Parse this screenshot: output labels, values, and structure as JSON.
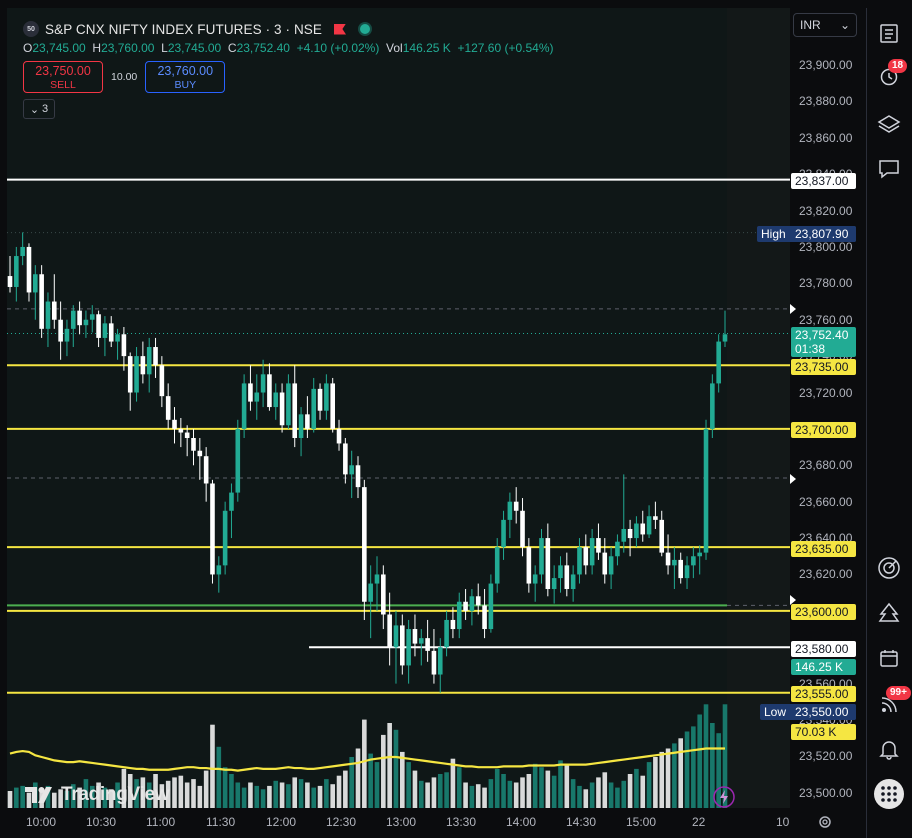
{
  "header": {
    "symbol_badge": "50",
    "title": "S&P CNX NIFTY INDEX FUTURES · 3 · NSE",
    "ohlc": {
      "o_label": "O",
      "o": "23,745.00",
      "h_label": "H",
      "h": "23,760.00",
      "l_label": "L",
      "l": "23,745.00",
      "c_label": "C",
      "c": "23,752.40",
      "change": "+4.10 (+0.02%)",
      "vol_label": "Vol",
      "vol": "146.25 K",
      "vol_change": "+127.60 (+0.54%)"
    }
  },
  "trade": {
    "sell_price": "23,750.00",
    "sell_label": "SELL",
    "spread": "10.00",
    "buy_price": "23,760.00",
    "buy_label": "BUY"
  },
  "layers": {
    "count": "3"
  },
  "currency": {
    "value": "INR"
  },
  "price_axis": {
    "ticks": [
      "23,900.00",
      "23,880.00",
      "23,860.00",
      "23,840.00",
      "23,820.00",
      "23,800.00",
      "23,780.00",
      "23,760.00",
      "23,740.00",
      "23,720.00",
      "23,700.00",
      "23,680.00",
      "23,660.00",
      "23,640.00",
      "23,620.00",
      "23,600.00",
      "23,580.00",
      "23,560.00",
      "23,540.00",
      "23,520.00",
      "23,500.00"
    ],
    "tick_values": [
      23900,
      23880,
      23860,
      23840,
      23820,
      23800,
      23780,
      23760,
      23740,
      23720,
      23700,
      23680,
      23660,
      23640,
      23620,
      23600,
      23580,
      23560,
      23540,
      23520,
      23500
    ]
  },
  "time_axis": [
    "10:00",
    "10:30",
    "11:00",
    "11:30",
    "12:00",
    "12:30",
    "13:00",
    "13:30",
    "14:00",
    "14:30",
    "15:00",
    "22",
    "10"
  ],
  "labels": {
    "line_837": "23,837.00",
    "high_tag": "High",
    "high": "23,807.90",
    "last_price": "23,752.40",
    "countdown": "01:38",
    "line_735": "23,735.00",
    "line_700": "23,700.00",
    "line_635": "23,635.00",
    "line_600": "23,600.00",
    "line_580": "23,580.00",
    "volume": "146.25 K",
    "line_555": "23,555.00",
    "low_tag": "Low",
    "low": "23,550.00",
    "vol_ma": "70.03 K"
  },
  "sidebar": {
    "alerts_badge": "18",
    "notifications_badge": "99+"
  },
  "branding": {
    "logo_text": "TradingView"
  },
  "colors": {
    "up": "#22ab94",
    "down": "#ffffff",
    "hline": "#f5e642",
    "white_line": "#ffffff",
    "last": "#22ab94",
    "high_low": "#1e3a6e",
    "ma": "#f5e642"
  },
  "chart_data": {
    "type": "candlestick",
    "price_range": [
      23492,
      23912
    ],
    "horizontal_lines": [
      23837,
      23735,
      23700,
      23635,
      23600,
      23555
    ],
    "white_segment": 23580,
    "green_dotted": 23603,
    "candles": [
      [
        23784,
        23795,
        23775,
        23778
      ],
      [
        23778,
        23800,
        23770,
        23795
      ],
      [
        23795,
        23808,
        23790,
        23800
      ],
      [
        23800,
        23802,
        23770,
        23775
      ],
      [
        23775,
        23790,
        23760,
        23785
      ],
      [
        23785,
        23790,
        23750,
        23755
      ],
      [
        23755,
        23775,
        23745,
        23770
      ],
      [
        23770,
        23785,
        23755,
        23760
      ],
      [
        23760,
        23770,
        23738,
        23748
      ],
      [
        23748,
        23760,
        23740,
        23755
      ],
      [
        23755,
        23768,
        23745,
        23765
      ],
      [
        23765,
        23770,
        23752,
        23757
      ],
      [
        23757,
        23765,
        23750,
        23760
      ],
      [
        23760,
        23768,
        23753,
        23763
      ],
      [
        23763,
        23765,
        23745,
        23750
      ],
      [
        23750,
        23762,
        23740,
        23758
      ],
      [
        23758,
        23762,
        23745,
        23748
      ],
      [
        23748,
        23755,
        23738,
        23752
      ],
      [
        23752,
        23756,
        23732,
        23740
      ],
      [
        23740,
        23742,
        23710,
        23720
      ],
      [
        23720,
        23745,
        23715,
        23740
      ],
      [
        23740,
        23748,
        23725,
        23730
      ],
      [
        23730,
        23750,
        23720,
        23745
      ],
      [
        23745,
        23750,
        23728,
        23735
      ],
      [
        23735,
        23740,
        23712,
        23718
      ],
      [
        23718,
        23725,
        23700,
        23705
      ],
      [
        23705,
        23712,
        23692,
        23700
      ],
      [
        23700,
        23706,
        23690,
        23698
      ],
      [
        23698,
        23702,
        23685,
        23695
      ],
      [
        23695,
        23700,
        23680,
        23688
      ],
      [
        23688,
        23695,
        23672,
        23685
      ],
      [
        23685,
        23690,
        23660,
        23670
      ],
      [
        23670,
        23672,
        23615,
        23620
      ],
      [
        23620,
        23630,
        23610,
        23625
      ],
      [
        23625,
        23660,
        23620,
        23655
      ],
      [
        23655,
        23670,
        23640,
        23665
      ],
      [
        23665,
        23705,
        23660,
        23700
      ],
      [
        23700,
        23730,
        23695,
        23725
      ],
      [
        23725,
        23735,
        23710,
        23715
      ],
      [
        23715,
        23730,
        23705,
        23720
      ],
      [
        23720,
        23738,
        23712,
        23730
      ],
      [
        23730,
        23736,
        23710,
        23712
      ],
      [
        23712,
        23725,
        23705,
        23720
      ],
      [
        23720,
        23725,
        23698,
        23702
      ],
      [
        23702,
        23730,
        23700,
        23725
      ],
      [
        23725,
        23735,
        23690,
        23695
      ],
      [
        23695,
        23712,
        23685,
        23708
      ],
      [
        23708,
        23718,
        23695,
        23700
      ],
      [
        23700,
        23728,
        23698,
        23722
      ],
      [
        23722,
        23725,
        23705,
        23710
      ],
      [
        23710,
        23730,
        23705,
        23725
      ],
      [
        23725,
        23728,
        23698,
        23700
      ],
      [
        23700,
        23705,
        23688,
        23692
      ],
      [
        23692,
        23695,
        23670,
        23675
      ],
      [
        23675,
        23688,
        23662,
        23680
      ],
      [
        23680,
        23685,
        23662,
        23668
      ],
      [
        23668,
        23672,
        23595,
        23605
      ],
      [
        23605,
        23625,
        23585,
        23615
      ],
      [
        23615,
        23630,
        23600,
        23620
      ],
      [
        23620,
        23625,
        23590,
        23598
      ],
      [
        23598,
        23610,
        23570,
        23580
      ],
      [
        23580,
        23600,
        23560,
        23592
      ],
      [
        23592,
        23598,
        23565,
        23570
      ],
      [
        23570,
        23595,
        23560,
        23590
      ],
      [
        23590,
        23598,
        23575,
        23582
      ],
      [
        23582,
        23590,
        23570,
        23585
      ],
      [
        23585,
        23595,
        23572,
        23578
      ],
      [
        23578,
        23590,
        23560,
        23565
      ],
      [
        23565,
        23585,
        23555,
        23580
      ],
      [
        23580,
        23600,
        23575,
        23595
      ],
      [
        23595,
        23602,
        23585,
        23590
      ],
      [
        23590,
        23610,
        23585,
        23605
      ],
      [
        23605,
        23612,
        23595,
        23600
      ],
      [
        23600,
        23612,
        23592,
        23608
      ],
      [
        23608,
        23615,
        23598,
        23603
      ],
      [
        23603,
        23612,
        23585,
        23590
      ],
      [
        23590,
        23620,
        23588,
        23615
      ],
      [
        23615,
        23640,
        23610,
        23635
      ],
      [
        23635,
        23655,
        23628,
        23650
      ],
      [
        23650,
        23665,
        23640,
        23660
      ],
      [
        23660,
        23668,
        23648,
        23655
      ],
      [
        23655,
        23662,
        23630,
        23635
      ],
      [
        23635,
        23640,
        23610,
        23615
      ],
      [
        23615,
        23625,
        23605,
        23620
      ],
      [
        23620,
        23645,
        23615,
        23640
      ],
      [
        23640,
        23648,
        23608,
        23612
      ],
      [
        23612,
        23625,
        23604,
        23618
      ],
      [
        23618,
        23630,
        23610,
        23625
      ],
      [
        23625,
        23632,
        23608,
        23612
      ],
      [
        23612,
        23625,
        23605,
        23620
      ],
      [
        23620,
        23640,
        23615,
        23635
      ],
      [
        23635,
        23642,
        23620,
        23625
      ],
      [
        23625,
        23645,
        23620,
        23640
      ],
      [
        23640,
        23648,
        23628,
        23632
      ],
      [
        23632,
        23640,
        23615,
        23620
      ],
      [
        23620,
        23635,
        23612,
        23630
      ],
      [
        23630,
        23642,
        23625,
        23638
      ],
      [
        23638,
        23675,
        23632,
        23645
      ],
      [
        23645,
        23650,
        23630,
        23640
      ],
      [
        23640,
        23652,
        23635,
        23648
      ],
      [
        23648,
        23655,
        23638,
        23642
      ],
      [
        23642,
        23658,
        23640,
        23652
      ],
      [
        23652,
        23660,
        23645,
        23650
      ],
      [
        23650,
        23655,
        23630,
        23632
      ],
      [
        23632,
        23642,
        23620,
        23625
      ],
      [
        23625,
        23635,
        23612,
        23628
      ],
      [
        23628,
        23632,
        23615,
        23618
      ],
      [
        23618,
        23630,
        23612,
        23625
      ],
      [
        23625,
        23635,
        23618,
        23630
      ],
      [
        23630,
        23636,
        23620,
        23632
      ],
      [
        23632,
        23705,
        23628,
        23700
      ],
      [
        23700,
        23730,
        23695,
        23725
      ],
      [
        23725,
        23752,
        23720,
        23748
      ],
      [
        23748,
        23765,
        23745,
        23752
      ]
    ],
    "volumes": [
      20,
      24,
      26,
      18,
      30,
      22,
      26,
      18,
      22,
      20,
      28,
      24,
      34,
      26,
      30,
      24,
      22,
      30,
      46,
      40,
      34,
      36,
      30,
      40,
      28,
      32,
      36,
      38,
      30,
      34,
      26,
      44,
      98,
      72,
      48,
      40,
      30,
      24,
      30,
      26,
      22,
      26,
      32,
      30,
      28,
      36,
      34,
      30,
      24,
      26,
      34,
      28,
      38,
      44,
      60,
      70,
      104,
      64,
      54,
      86,
      100,
      92,
      66,
      54,
      44,
      32,
      30,
      36,
      40,
      42,
      58,
      48,
      30,
      26,
      28,
      24,
      34,
      46,
      40,
      32,
      30,
      36,
      40,
      52,
      48,
      44,
      38,
      56,
      50,
      34,
      26,
      22,
      30,
      36,
      42,
      30,
      24,
      32,
      40,
      46,
      38,
      54,
      60,
      66,
      70,
      76,
      82,
      90,
      96,
      110,
      122,
      100,
      88,
      122
    ],
    "vol_ma": [
      64,
      66,
      67,
      66,
      62,
      60,
      58,
      56,
      55,
      54,
      54,
      55,
      54,
      53,
      52,
      51,
      50,
      49,
      48,
      47,
      46,
      46,
      45,
      45,
      45,
      45,
      46,
      47,
      48,
      48,
      47,
      47,
      46,
      46,
      45,
      45,
      44,
      45,
      46,
      47,
      46,
      46,
      46,
      47,
      48,
      47,
      47,
      46,
      46,
      47,
      48,
      49,
      50,
      51,
      52,
      53,
      55,
      57,
      58,
      59,
      60,
      60,
      59,
      58,
      57,
      56,
      55,
      54,
      53,
      52,
      51,
      50,
      49,
      49,
      48,
      48,
      48,
      48,
      49,
      49,
      49,
      49,
      50,
      50,
      50,
      50,
      50,
      51,
      51,
      51,
      51,
      51,
      52,
      53,
      54,
      55,
      56,
      57,
      58,
      59,
      60,
      61,
      62,
      63,
      64,
      65,
      66,
      67,
      68,
      69,
      70,
      70,
      70,
      70
    ]
  }
}
